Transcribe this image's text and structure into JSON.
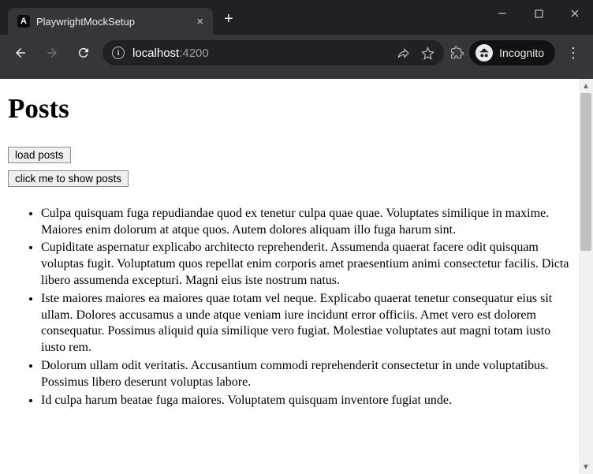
{
  "browser": {
    "tab_title": "PlaywrightMockSetup",
    "tab_favicon_letter": "A",
    "url_host": "localhost",
    "url_port": ":4200",
    "incognito_label": "Incognito"
  },
  "page": {
    "heading": "Posts",
    "buttons": {
      "load_posts": "load posts",
      "show_posts": "click me to show posts"
    },
    "posts": [
      "Culpa quisquam fuga repudiandae quod ex tenetur culpa quae quae. Voluptates similique in maxime. Maiores enim dolorum at atque quos. Autem dolores aliquam illo fuga harum sint.",
      "Cupiditate aspernatur explicabo architecto reprehenderit. Assumenda quaerat facere odit quisquam voluptas fugit. Voluptatum quos repellat enim corporis amet praesentium animi consectetur facilis. Dicta libero assumenda excepturi. Magni eius iste nostrum natus.",
      "Iste maiores maiores ea maiores quae totam vel neque. Explicabo quaerat tenetur consequatur eius sit ullam. Dolores accusamus a unde atque veniam iure incidunt error officiis. Amet vero est dolorem consequatur. Possimus aliquid quia similique vero fugiat. Molestiae voluptates aut magni totam iusto iusto rem.",
      "Dolorum ullam odit veritatis. Accusantium commodi reprehenderit consectetur in unde voluptatibus. Possimus libero deserunt voluptas labore.",
      "Id culpa harum beatae fuga maiores. Voluptatem quisquam inventore fugiat unde."
    ]
  }
}
